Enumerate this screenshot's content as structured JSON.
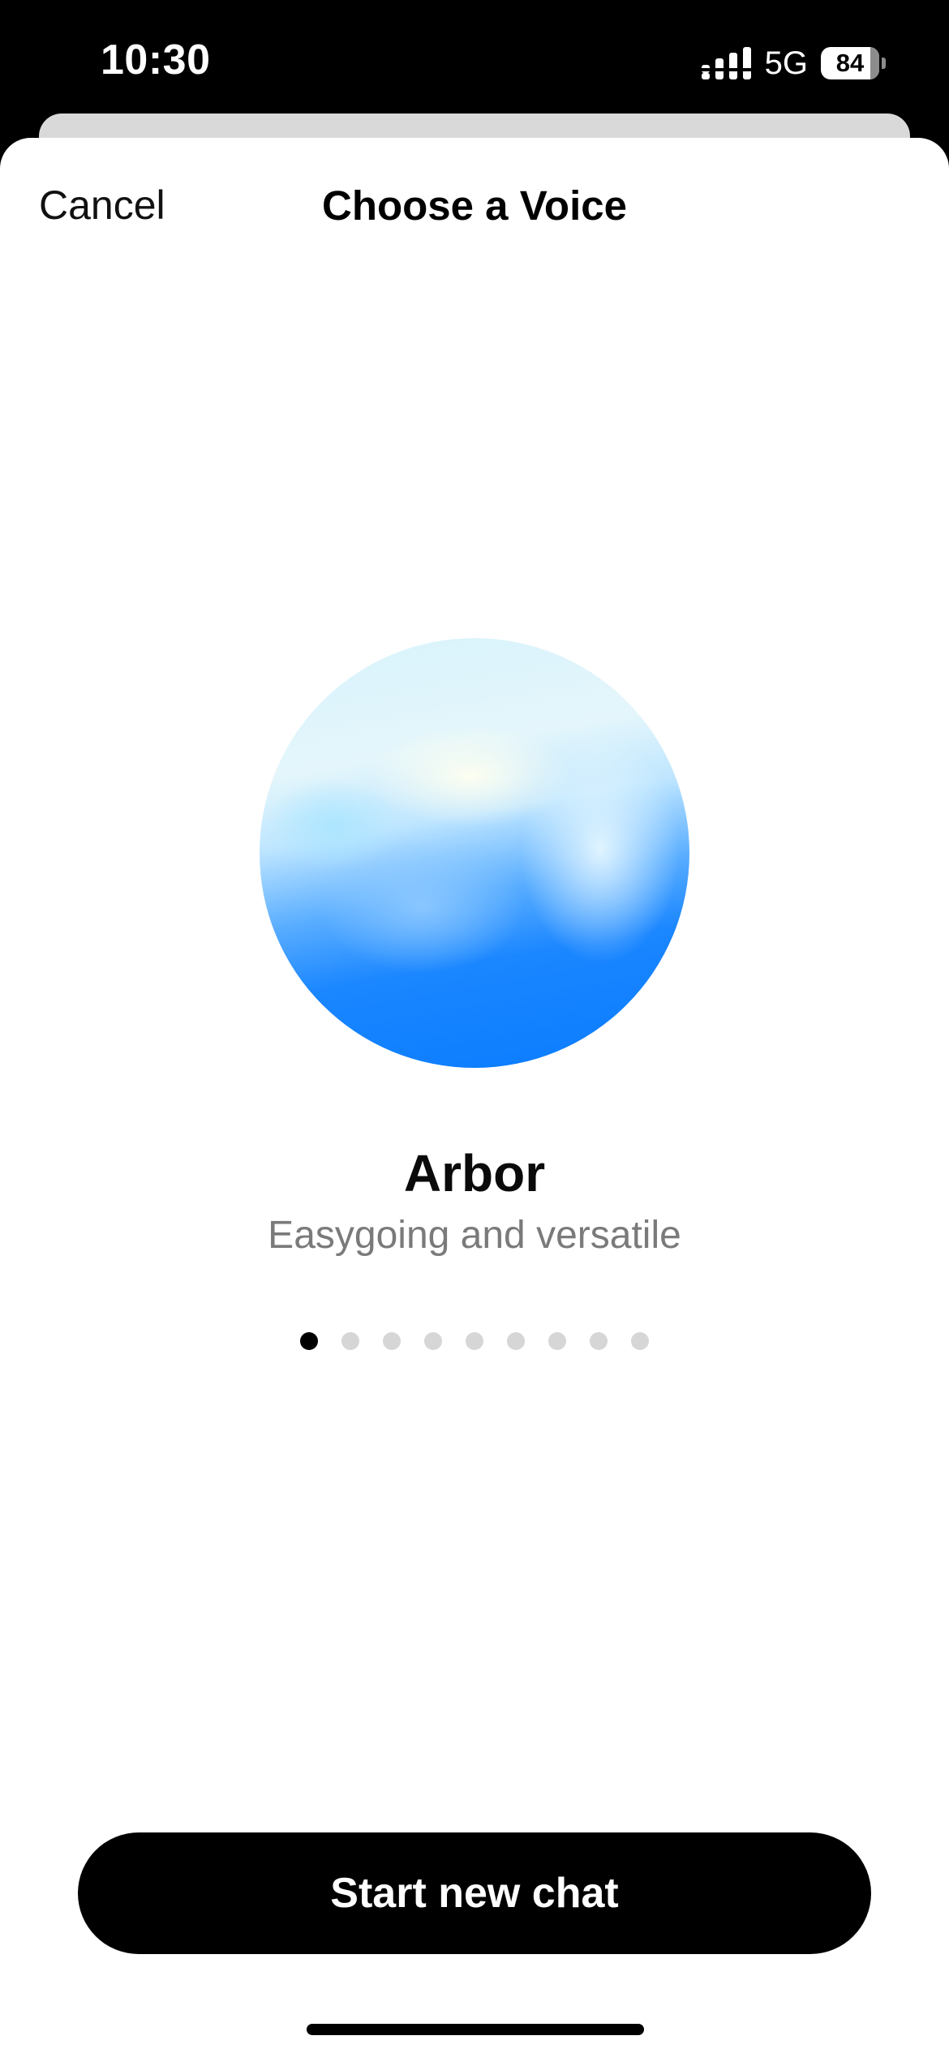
{
  "status_bar": {
    "time": "10:30",
    "network": "5G",
    "battery_level": "84",
    "icons": [
      "signal-icon",
      "battery-icon"
    ]
  },
  "nav": {
    "cancel_label": "Cancel",
    "title": "Choose a Voice"
  },
  "voice": {
    "name": "Arbor",
    "description": "Easygoing and versatile",
    "page_count": 9,
    "active_page": 1
  },
  "actions": {
    "start_label": "Start new chat"
  },
  "colors": {
    "background": "#ffffff",
    "button": "#000000",
    "button_text": "#ffffff",
    "dot_inactive": "#d6d6d6",
    "dot_active": "#000000",
    "orb_blue": "#0a7cff"
  }
}
